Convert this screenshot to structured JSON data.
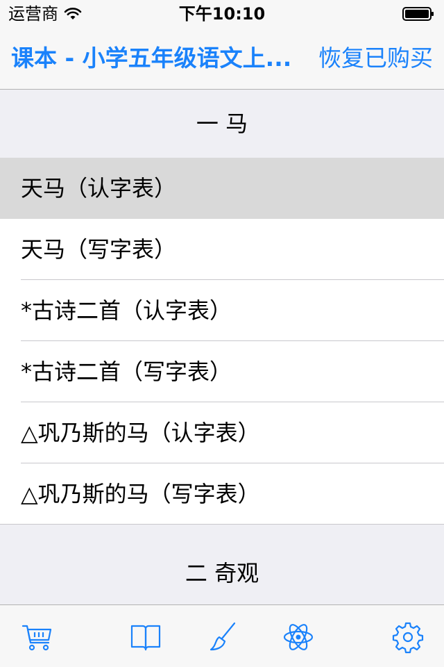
{
  "status_bar": {
    "carrier": "运营商",
    "time": "下午10:10"
  },
  "nav": {
    "title": "课本 - 小学五年级语文上...",
    "restore_label": "恢复已购买"
  },
  "sections": [
    {
      "header": "一 马",
      "rows": [
        "天马（认字表）",
        "天马（写字表）",
        "*古诗二首（认字表）",
        "*古诗二首（写字表）",
        "△巩乃斯的马（认字表）",
        "△巩乃斯的马（写字表）"
      ],
      "selected_index": 0
    },
    {
      "header": "二 奇观"
    }
  ],
  "tab_bar": {
    "items": [
      {
        "icon": "cart-icon"
      },
      {
        "icon": "book-icon"
      },
      {
        "icon": "brush-icon"
      },
      {
        "icon": "atom-icon"
      },
      {
        "icon": "gear-icon"
      }
    ]
  },
  "colors": {
    "accent": "#1a82fb",
    "selected_row": "#d9d9d9",
    "section_bg": "#efeff4"
  }
}
